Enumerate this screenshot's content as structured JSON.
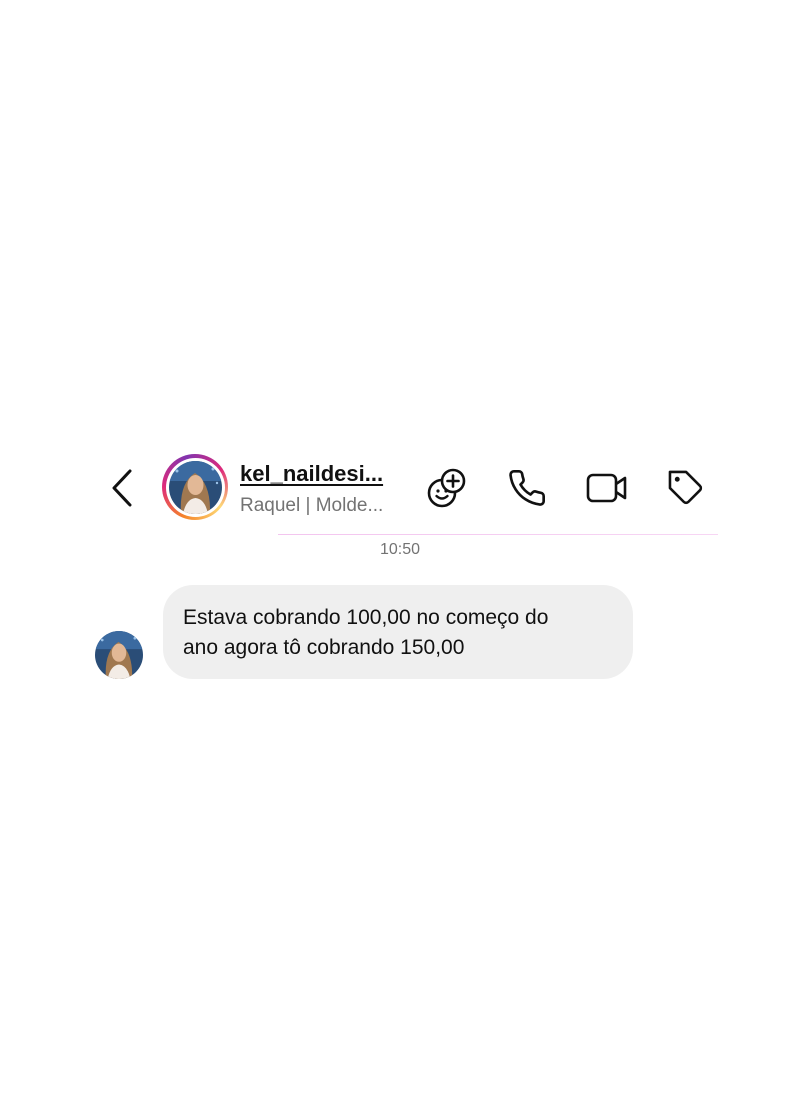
{
  "header": {
    "back_icon": "chevron-left-icon",
    "username": "kel_naildesi...",
    "subtitle": "Raquel | Molde...",
    "actions": [
      {
        "icon": "add-sticker-icon"
      },
      {
        "icon": "phone-icon"
      },
      {
        "icon": "video-camera-icon"
      },
      {
        "icon": "tag-icon"
      }
    ]
  },
  "conversation": {
    "timestamp": "10:50",
    "messages": [
      {
        "sender": "kel_naildesi...",
        "lines": [
          "Estava cobrando 100,00 no começo do",
          "ano agora tô cobrando 150,00"
        ]
      }
    ]
  },
  "colors": {
    "story_ring": [
      "#f58529",
      "#dd2a7b",
      "#8134af",
      "#feda77"
    ],
    "bubble": "#efefef",
    "secondary_text": "#737373",
    "divider": "#f3c5ef"
  }
}
